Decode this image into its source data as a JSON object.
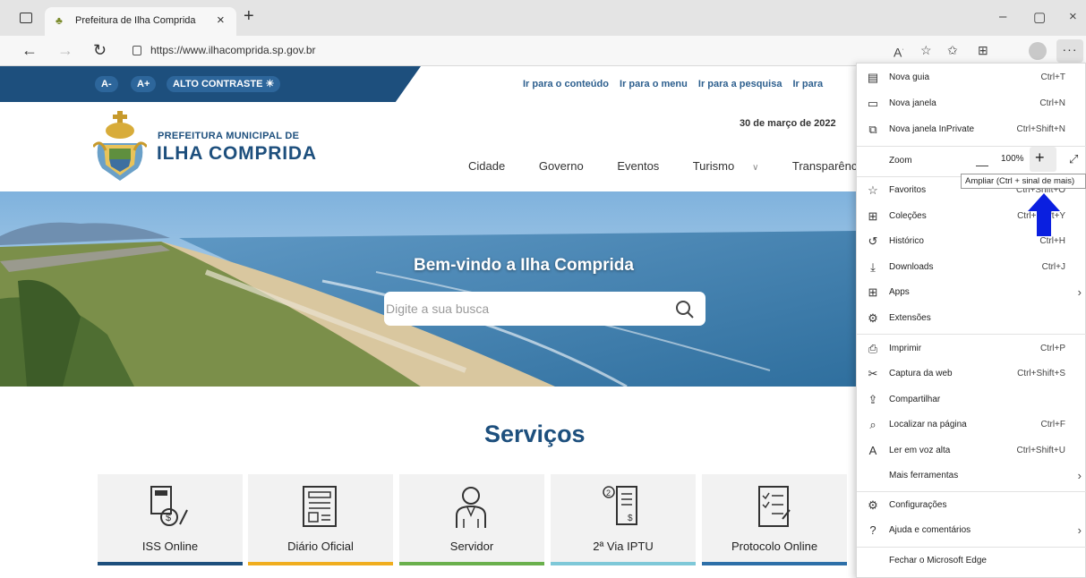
{
  "browser": {
    "tab_title": "Prefeitura de Ilha Comprida",
    "tab_close": "×",
    "new_tab": "+",
    "url": "https://www.ilhacomprida.sp.gov.br",
    "window_controls": [
      "–",
      "▢",
      "×"
    ]
  },
  "site": {
    "accessibility": {
      "decrease_font": "A-",
      "increase_font": "A+",
      "high_contrast": "ALTO CONTRASTE ☀"
    },
    "skip_links": [
      "Ir para o conteúdo",
      "Ir para o menu",
      "Ir para a pesquisa",
      "Ir para"
    ],
    "org_subtitle": "PREFEITURA MUNICIPAL DE",
    "org_name": "ILHA COMPRIDA",
    "date": "30 de março de 2022",
    "nav": [
      {
        "label": "Cidade",
        "dropdown": false
      },
      {
        "label": "Governo",
        "dropdown": false
      },
      {
        "label": "Eventos",
        "dropdown": false
      },
      {
        "label": "Turismo",
        "dropdown": true
      },
      {
        "label": "Transparência",
        "dropdown": true
      }
    ],
    "hero": {
      "title": "Bem-vindo a Ilha Comprida",
      "search_placeholder": "Digite a sua busca"
    },
    "services_title": "Serviços",
    "services": [
      {
        "label": "ISS Online",
        "color": "#1d4f7d"
      },
      {
        "label": "Diário Oficial",
        "color": "#f0ad1e"
      },
      {
        "label": "Servidor",
        "color": "#6ab04c"
      },
      {
        "label": "2ª Via IPTU",
        "color": "#7ec8d8"
      },
      {
        "label": "Protocolo Online",
        "color": "#2d6fa8"
      }
    ]
  },
  "menu": {
    "items_top": [
      {
        "icon": "tab-icon",
        "glyph": "▤",
        "label": "Nova guia",
        "shortcut": "Ctrl+T"
      },
      {
        "icon": "window-icon",
        "glyph": "▭",
        "label": "Nova janela",
        "shortcut": "Ctrl+N"
      },
      {
        "icon": "inprivate-icon",
        "glyph": "⧉",
        "label": "Nova janela InPrivate",
        "shortcut": "Ctrl+Shift+N"
      }
    ],
    "zoom_label": "Zoom",
    "zoom_minus": "—",
    "zoom_value": "100%",
    "zoom_plus": "+",
    "fullscreen": "⤢",
    "tooltip": "Ampliar (Ctrl + sinal de mais)",
    "items_mid": [
      {
        "icon": "favorites-icon",
        "glyph": "☆",
        "label": "Favoritos",
        "shortcut": "Ctrl+Shift+O"
      },
      {
        "icon": "collections-icon",
        "glyph": "⊞",
        "label": "Coleções",
        "shortcut": "Ctrl+Shift+Y"
      },
      {
        "icon": "history-icon",
        "glyph": "↺",
        "label": "Histórico",
        "shortcut": "Ctrl+H"
      },
      {
        "icon": "downloads-icon",
        "glyph": "⤓",
        "label": "Downloads",
        "shortcut": "Ctrl+J"
      },
      {
        "icon": "apps-icon",
        "glyph": "⊞",
        "label": "Apps",
        "shortcut": "",
        "submenu": true
      },
      {
        "icon": "extensions-icon",
        "glyph": "⚙",
        "label": "Extensões",
        "shortcut": ""
      }
    ],
    "items_low": [
      {
        "icon": "print-icon",
        "glyph": "⎙",
        "label": "Imprimir",
        "shortcut": "Ctrl+P"
      },
      {
        "icon": "web-capture-icon",
        "glyph": "✂",
        "label": "Captura da web",
        "shortcut": "Ctrl+Shift+S"
      },
      {
        "icon": "share-icon",
        "glyph": "⇪",
        "label": "Compartilhar",
        "shortcut": ""
      },
      {
        "icon": "find-icon",
        "glyph": "⌕",
        "label": "Localizar na página",
        "shortcut": "Ctrl+F"
      },
      {
        "icon": "read-aloud-icon",
        "glyph": "A",
        "label": "Ler em voz alta",
        "shortcut": "Ctrl+Shift+U"
      },
      {
        "icon": "",
        "glyph": "",
        "label": "Mais ferramentas",
        "shortcut": "",
        "submenu": true
      }
    ],
    "items_bottom": [
      {
        "icon": "settings-icon",
        "glyph": "⚙",
        "label": "Configurações",
        "shortcut": ""
      },
      {
        "icon": "help-icon",
        "glyph": "?",
        "label": "Ajuda e comentários",
        "shortcut": "",
        "submenu": true
      }
    ],
    "close_label": "Fechar o Microsoft Edge"
  }
}
